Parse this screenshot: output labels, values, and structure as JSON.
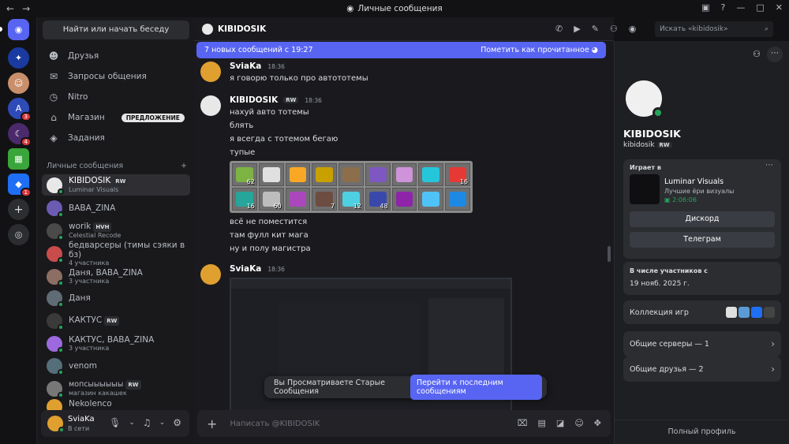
{
  "window": {
    "title": "Личные сообщения",
    "nav_back": "←",
    "nav_fwd": "→"
  },
  "sidebar": {
    "search": "Найти или начать беседу",
    "nav": [
      {
        "label": "Друзья",
        "icon": "friends-icon"
      },
      {
        "label": "Запросы общения",
        "icon": "inbox-icon"
      },
      {
        "label": "Nitro",
        "icon": "nitro-icon"
      },
      {
        "label": "Магазин",
        "icon": "shop-icon",
        "pill": "ПРЕДЛОЖЕНИЕ"
      },
      {
        "label": "Задания",
        "icon": "quests-icon"
      }
    ],
    "section": "Личные сообщения",
    "section_add": "+",
    "dms": [
      {
        "name": "KIBIDOSIK",
        "tag": "RW",
        "sub": "Luminar Visuals",
        "color": "#e8e8e8"
      },
      {
        "name": "BABA_ZINA",
        "tag": "",
        "sub": "",
        "color": "#6b5bb3"
      },
      {
        "name": "worik",
        "tag": "HVH",
        "sub": "Celestial Recode",
        "color": "#4a4a4a"
      },
      {
        "name": "бедварсеры (тимы сэяки в бз)",
        "tag": "",
        "sub": "4 участника",
        "color": "#c94c4c"
      },
      {
        "name": "Даня, BABA_ZINA",
        "tag": "",
        "sub": "3 участника",
        "color": "#8d6e63"
      },
      {
        "name": "Даня",
        "tag": "",
        "sub": "",
        "color": "#5f6b75"
      },
      {
        "name": "КАКТУС",
        "tag": "RW",
        "sub": "",
        "color": "#3a3a3a"
      },
      {
        "name": "КАКТУС, BABA_ZINA",
        "tag": "",
        "sub": "3 участника",
        "color": "#9c6ade"
      },
      {
        "name": "venom",
        "tag": "",
        "sub": "",
        "color": "#546e7a"
      },
      {
        "name": "мопсыыыыыы",
        "tag": "RW",
        "sub": "магазин какашек",
        "color": "#777"
      },
      {
        "name": "Nekolenco",
        "tag": "",
        "sub": "",
        "color": "#e0a030"
      }
    ]
  },
  "user": {
    "name": "SviaKa",
    "status": "В сети"
  },
  "guilds": {
    "badges": [
      "3",
      "4",
      "1"
    ]
  },
  "chat": {
    "title": "KIBIDOSIK",
    "search_placeholder": "Искать «kibidosik»",
    "banner": "7 новых сообщений с 19:27",
    "banner_action": "Пометить как прочитанное",
    "messages": [
      {
        "author": "SviaKa",
        "time": "18:36",
        "lines": [
          "я говорю только про автототемы"
        ]
      },
      {
        "author": "KIBIDOSIK",
        "tag": "RW",
        "time": "18:36",
        "lines": [
          "нахуй авто тотемы",
          "блять",
          "я всегда с тотемом бегаю",
          "тупые"
        ]
      },
      {
        "lines": [
          "всё не поместится",
          "там фулл кит мага",
          "ну и полу магистра"
        ]
      },
      {
        "author": "SviaKa",
        "time": "18:36"
      }
    ],
    "inventory_counts": [
      "62",
      "",
      "",
      "",
      "",
      "",
      "",
      "",
      "16",
      "16",
      "60",
      "",
      "7",
      "12",
      "48",
      "",
      "",
      ""
    ],
    "toast": "Вы Просматриваете Старые Сообщения",
    "toast_action": "Перейти к последним сообщениям",
    "composer_placeholder": "Написать @KIBIDOSIK"
  },
  "profile": {
    "name": "KIBIDOSIK",
    "username": "kibidosik",
    "tag": "RW",
    "playing_label": "Играет в",
    "activity_title": "Luminar Visuals",
    "activity_sub": "Лучшие ёри визуалы",
    "activity_time": "2:06:06",
    "btn1": "Дискорд",
    "btn2": "Телеграм",
    "member_label": "В числе участников с",
    "member_date": "19 нояб. 2025 г.",
    "games_label": "Коллекция игр",
    "servers": "Общие серверы — 1",
    "friends": "Общие друзья — 2",
    "full": "Полный профиль"
  }
}
